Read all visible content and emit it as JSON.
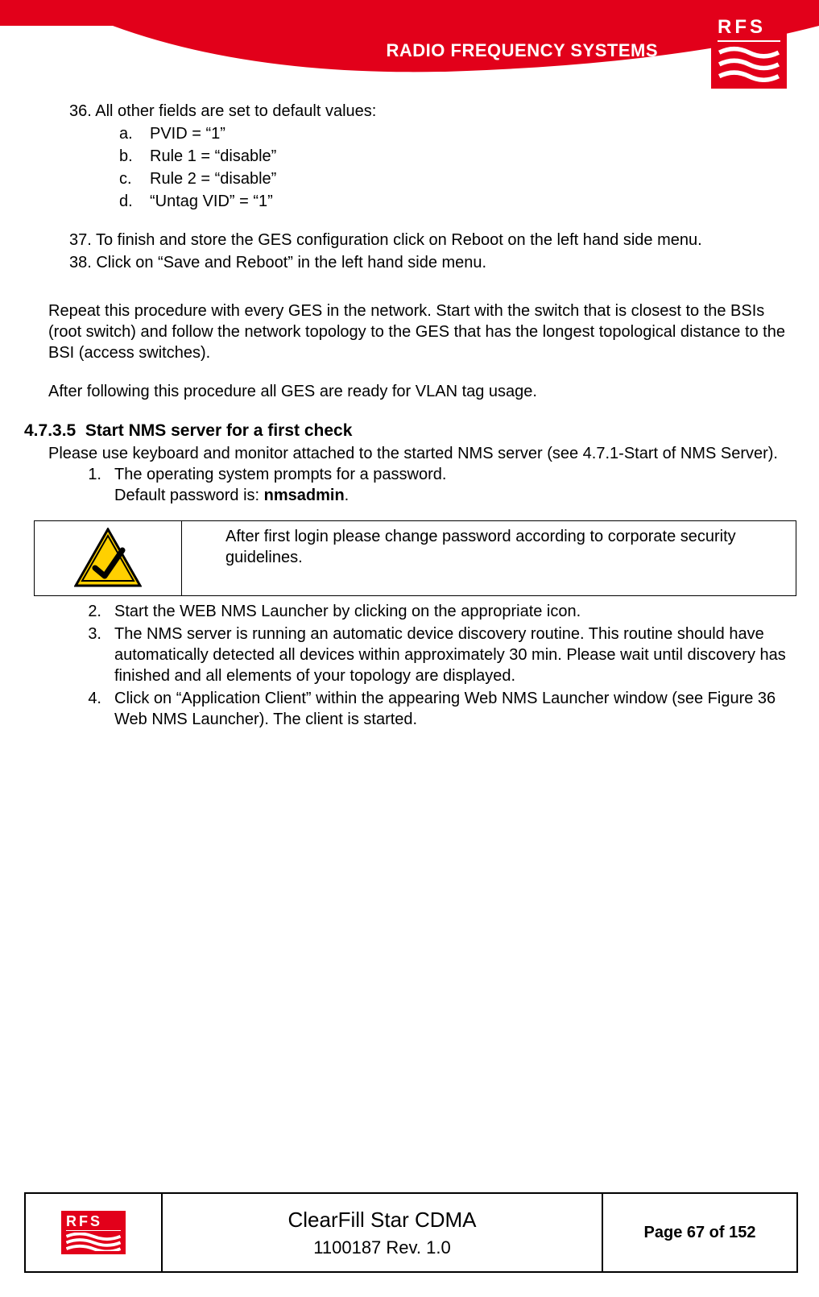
{
  "header": {
    "company_name": "RADIO FREQUENCY SYSTEMS",
    "logo_text": "RFS"
  },
  "body": {
    "item36_intro": "36. All other fields are set to default values:",
    "item36_sub": [
      {
        "marker": "a.",
        "text": "PVID = “1”"
      },
      {
        "marker": "b.",
        "text": "Rule 1 = “disable”"
      },
      {
        "marker": "c.",
        "text": "Rule 2 = “disable”"
      },
      {
        "marker": "d.",
        "text": "“Untag VID” = “1”"
      }
    ],
    "item37": "37. To finish and store the GES configuration click on Reboot on the left hand side menu.",
    "item38": "38. Click on “Save and Reboot” in the left hand side menu.",
    "para1": "Repeat this procedure with every GES in the network. Start with the switch that is closest to the BSIs (root switch) and follow the network topology to the GES that has the longest topological distance to the BSI (access switches).",
    "para2": "After following this procedure all GES are ready for VLAN tag usage.",
    "h5_num": "4.7.3.5",
    "h5_title": "Start NMS server for a first check",
    "para3": "Please use keyboard and monitor attached to the started NMS server (see 4.7.1-Start of NMS Server).",
    "step1_marker": "1.",
    "step1_a": "The operating system prompts for a password.",
    "step1_b_pre": "Default password is: ",
    "step1_b_bold": "nmsadmin",
    "step1_b_post": ".",
    "warning_text": "After first login please change password according to corporate security guidelines.",
    "step2_marker": "2.",
    "step2": "Start the WEB NMS Launcher by clicking on the appropriate icon.",
    "step3_marker": "3.",
    "step3": "The NMS server is running an automatic device discovery routine. This routine should have automatically detected all devices within approximately 30 min. Please wait until discovery has finished and all elements of your topology are displayed.",
    "step4_marker": "4.",
    "step4": "Click on “Application Client” within the appearing Web NMS Launcher window (see Figure 36 Web NMS Launcher). The client is started."
  },
  "footer": {
    "logo_text": "RFS",
    "doc_title": "ClearFill Star CDMA",
    "doc_rev": "1100187 Rev. 1.0",
    "page_label": "Page 67 of 152"
  }
}
